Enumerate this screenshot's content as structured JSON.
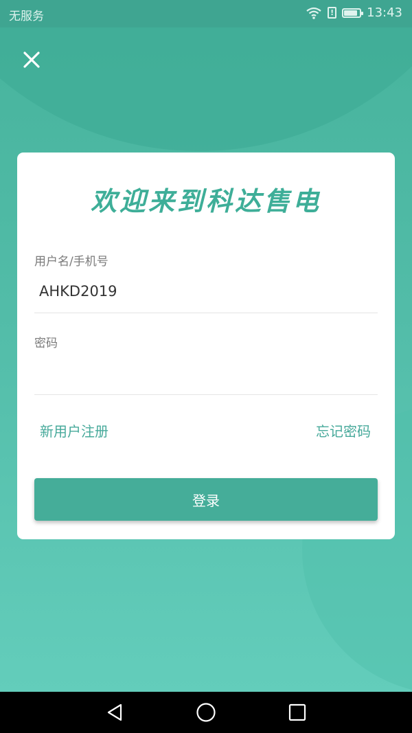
{
  "status_bar": {
    "carrier": "无服务",
    "time": "13:43",
    "battery_level": 0.85,
    "icons": [
      "wifi-icon",
      "alert-icon",
      "battery-icon"
    ]
  },
  "close_icon": "close-icon",
  "card": {
    "title": "欢迎来到科达售电",
    "username": {
      "label": "用户名/手机号",
      "value": "AHKD2019"
    },
    "password": {
      "label": "密码",
      "value": ""
    },
    "register_link": "新用户注册",
    "forgot_link": "忘记密码",
    "login_button": "登录"
  },
  "nav_bar": {
    "icons": [
      "back-icon",
      "home-icon",
      "recents-icon"
    ]
  },
  "colors": {
    "accent": "#45ad99",
    "link": "#46a99a",
    "title": "#3eae98",
    "background": "#52bca8"
  }
}
